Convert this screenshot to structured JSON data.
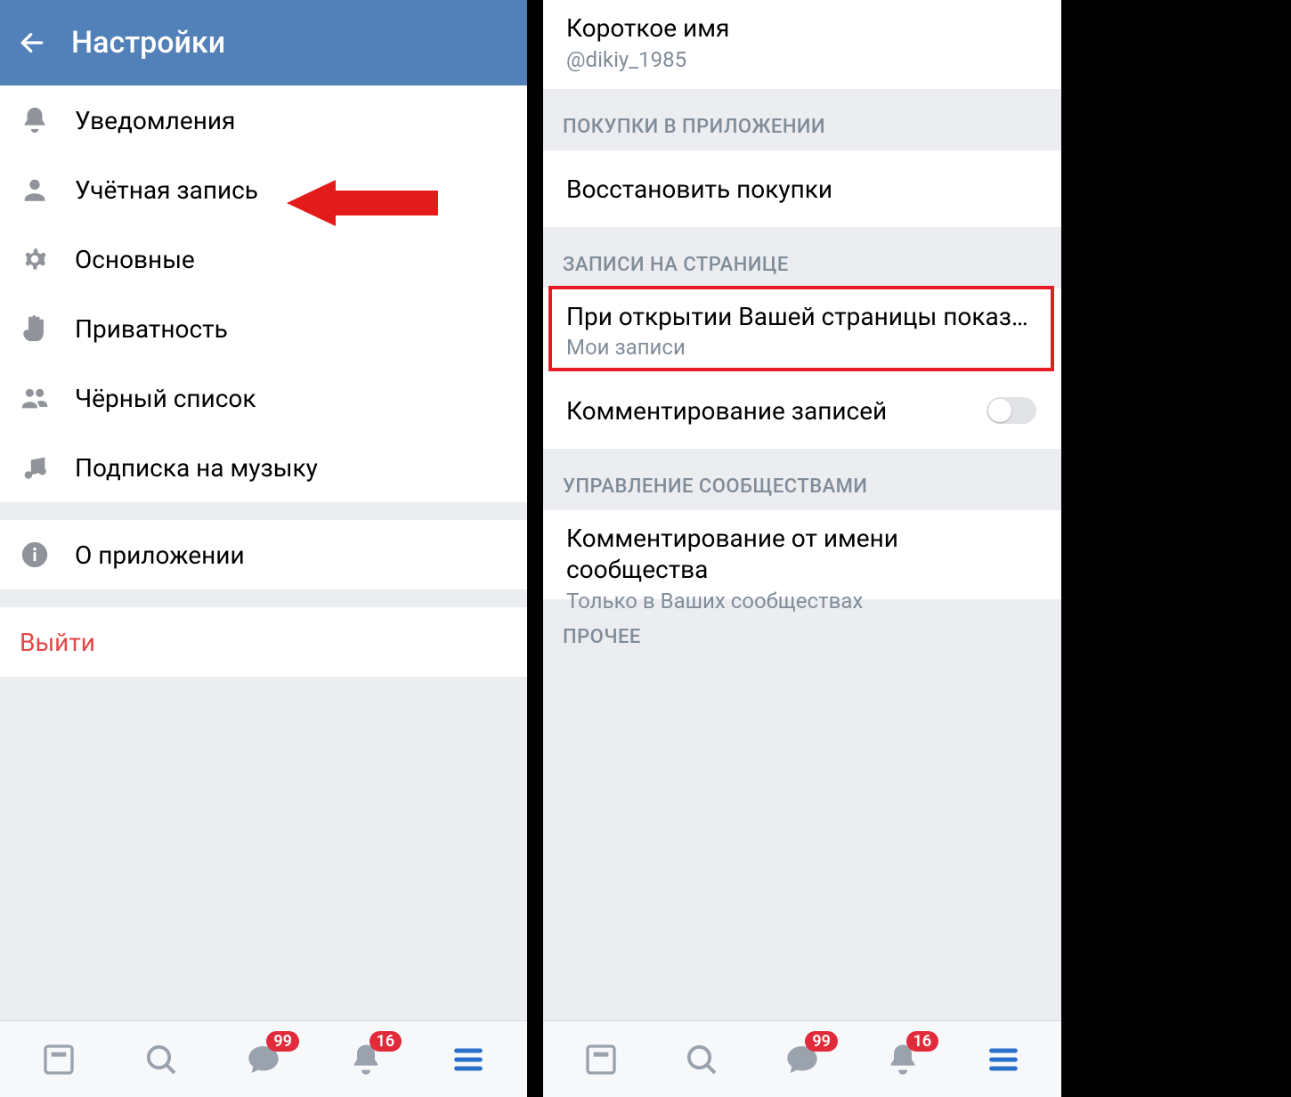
{
  "left": {
    "header_title": "Настройки",
    "items": {
      "notifications": "Уведомления",
      "account": "Учётная запись",
      "general": "Основные",
      "privacy": "Приватность",
      "blacklist": "Чёрный список",
      "music": "Подписка на музыку",
      "about": "О приложении",
      "logout": "Выйти"
    }
  },
  "right": {
    "short_name_label": "Короткое имя",
    "short_name_value": "@dikiy_1985",
    "section_purchases": "ПОКУПКИ В ПРИЛОЖЕНИИ",
    "restore_purchases": "Восстановить покупки",
    "section_wall": "ЗАПИСИ НА СТРАНИЦЕ",
    "wall_open_label": "При открытии Вашей страницы показыват..",
    "wall_open_value": "Мои записи",
    "comments_label": "Комментирование записей",
    "section_communities": "УПРАВЛЕНИЕ СООБЩЕСТВАМИ",
    "community_comment_label": "Комментирование от имени сообщества",
    "community_comment_value": "Только в Ваших сообществах",
    "section_other": "ПРОЧЕЕ"
  },
  "nav": {
    "messages_badge": "99",
    "notifications_badge": "16"
  }
}
